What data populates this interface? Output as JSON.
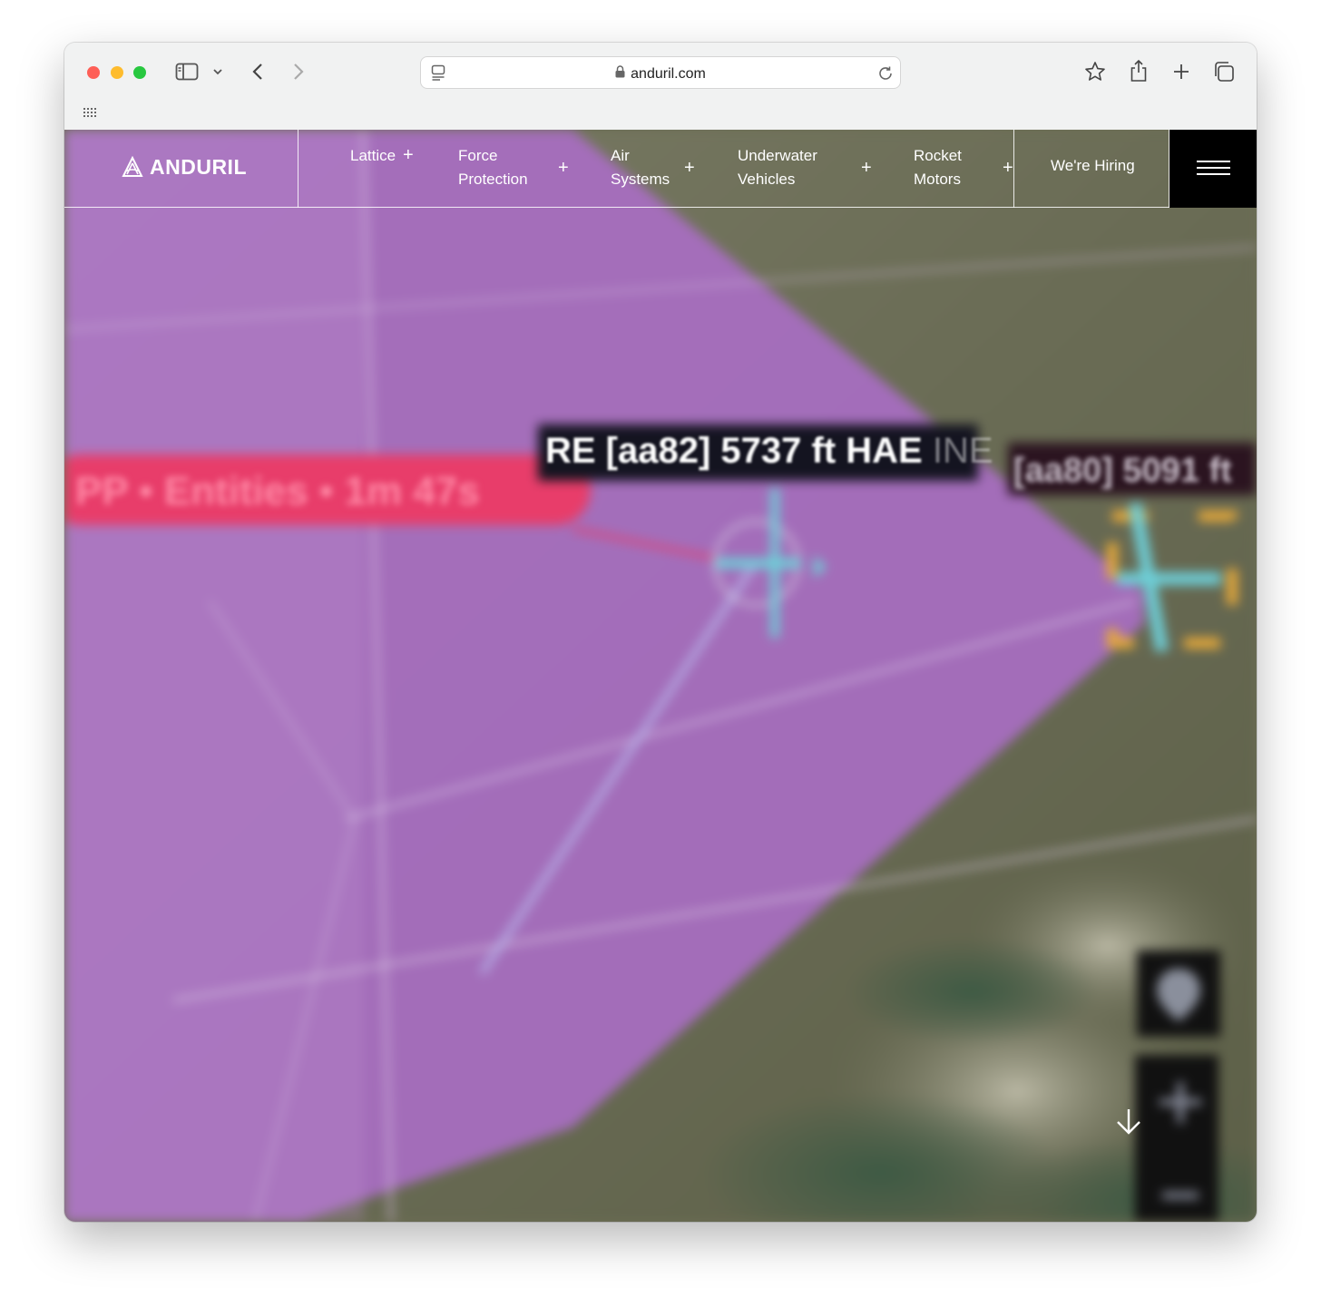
{
  "browser": {
    "url": "anduril.com",
    "icons": [
      "sidebar-icon",
      "chevron-down-icon",
      "back-icon",
      "forward-icon",
      "reader-icon",
      "lock-icon",
      "reload-icon",
      "bookmark-star-icon",
      "share-icon",
      "new-tab-icon",
      "tabs-overview-icon",
      "apps-grid-icon"
    ]
  },
  "site": {
    "logo_text": "ANDURIL",
    "nav": [
      {
        "line1": "Lattice",
        "line2": ""
      },
      {
        "line1": "Force",
        "line2": "Protection"
      },
      {
        "line1": "Air",
        "line2": "Systems"
      },
      {
        "line1": "Underwater",
        "line2": "Vehicles"
      },
      {
        "line1": "Rocket",
        "line2": "Motors"
      }
    ],
    "hiring_label": "We're Hiring",
    "menu_icon": "hamburger-icon",
    "scroll_icon": "arrow-down-icon"
  },
  "hero": {
    "track_label": "RE [aa82] 5737 ft HAE",
    "track_label_suffix": "INE",
    "track_label_2": "[aa80] 5091 ft",
    "alert_label": "PP • Entities • 1m 47s",
    "colors": {
      "sensor_cone": "#a86ec2",
      "alert": "#e83d6a",
      "target": "#6ecfd8",
      "lock_box": "#e6a93a",
      "terrain": "#6c6e55"
    }
  }
}
